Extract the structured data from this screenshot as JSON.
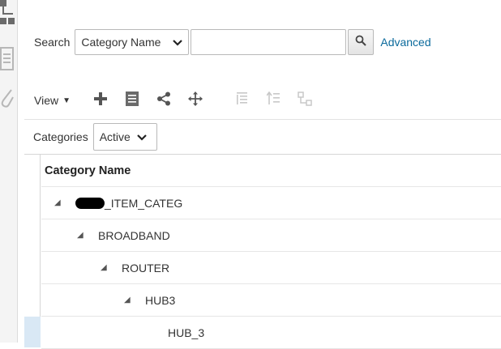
{
  "search": {
    "label": "Search",
    "field_selected": "Category Name",
    "input_value": "",
    "advanced_label": "Advanced"
  },
  "toolbar": {
    "view_label": "View",
    "icons": [
      "add-icon",
      "details-icon",
      "share-icon",
      "move-icon",
      "expand-all-icon",
      "collapse-all-icon",
      "hierarchy-icon"
    ]
  },
  "categories_filter": {
    "label": "Categories",
    "selected": "Active"
  },
  "table": {
    "header": "Category Name",
    "rows": [
      {
        "label": "_ITEM_CATEG",
        "redacted_prefix": true
      },
      {
        "label": "BROADBAND"
      },
      {
        "label": "ROUTER"
      },
      {
        "label": "HUB3"
      },
      {
        "label": "HUB_3"
      }
    ]
  },
  "colors": {
    "link": "#0b6a9c",
    "selection": "#d9e8f5",
    "border": "#b9b9b9"
  }
}
